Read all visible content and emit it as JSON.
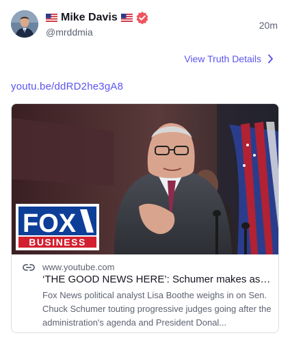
{
  "post": {
    "author": {
      "name": "Mike Davis",
      "handle": "@mrddmia",
      "avatar_icon": "avatar-photo",
      "flag_icon": "us-flag-icon",
      "verified_icon": "verified-badge-icon"
    },
    "time": "20m",
    "details_link": "View Truth Details",
    "url": "youtu.be/ddRD2he3gA8"
  },
  "card": {
    "domain": "www.youtube.com",
    "title": "‘THE GOOD NEWS HERE’: Schumer makes asto...",
    "description": "Fox News political analyst Lisa Boothe weighs in on Sen. Chuck Schumer touting progressive judges going after the administration's agenda and President Donal...",
    "logo": {
      "line1": "FOX",
      "line2": "BUSINESS"
    }
  },
  "colors": {
    "link": "#5b54f0",
    "verified": "#f0535e",
    "text": "#15151f",
    "muted": "#5e6272",
    "fox_blue": "#0d3f99",
    "fox_red": "#d2202f"
  }
}
